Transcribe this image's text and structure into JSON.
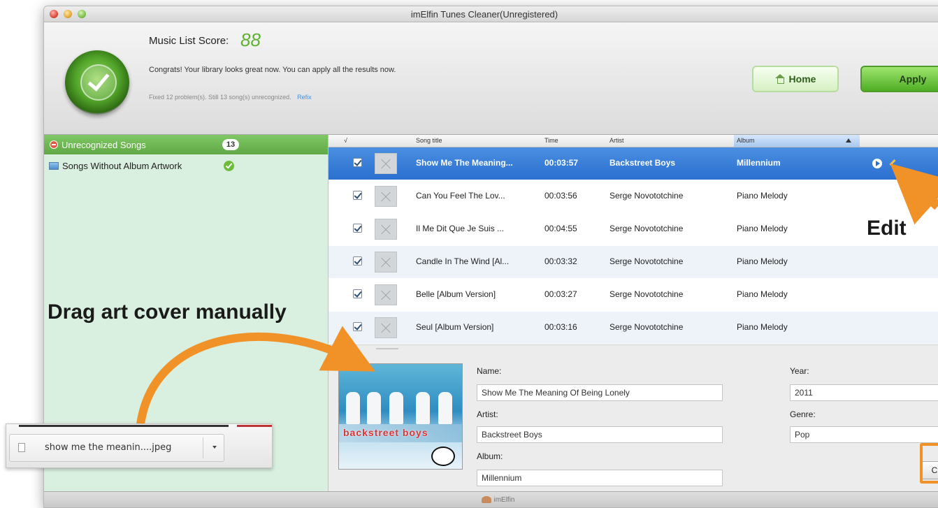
{
  "window": {
    "title": "imElfin Tunes Cleaner(Unregistered)"
  },
  "header": {
    "score_label": "Music List Score:",
    "score_value": "88",
    "congrats": "Congrats! Your library looks great now. You can apply all the results now.",
    "fixed_text": "Fixed 12 problem(s). Still 13 song(s) unrecognized.",
    "refix_link": "Refix",
    "home_label": "Home",
    "apply_label": "Apply"
  },
  "sidebar": {
    "items": [
      {
        "label": "Unrecognized Songs",
        "badge": "13"
      },
      {
        "label": "Songs Without Album Artwork"
      }
    ]
  },
  "table": {
    "headers": {
      "check": "√",
      "song_title": "Song title",
      "time": "Time",
      "artist": "Artist",
      "album": "Album"
    },
    "rows": [
      {
        "title": "Show Me The Meaning...",
        "time": "00:03:57",
        "artist": "Backstreet Boys",
        "album": "Millennium",
        "checked": true
      },
      {
        "title": "Can You Feel The Lov...",
        "time": "00:03:56",
        "artist": "Serge Novototchine",
        "album": "Piano Melody",
        "checked": true
      },
      {
        "title": "Il Me Dit Que Je Suis ...",
        "time": "00:04:55",
        "artist": "Serge Novototchine",
        "album": "Piano Melody",
        "checked": true
      },
      {
        "title": "Candle In The Wind [Al...",
        "time": "00:03:32",
        "artist": "Serge Novototchine",
        "album": "Piano Melody",
        "checked": true
      },
      {
        "title": "Belle [Album Version]",
        "time": "00:03:27",
        "artist": "Serge Novototchine",
        "album": "Piano Melody",
        "checked": true
      },
      {
        "title": "Seul [Album Version]",
        "time": "00:03:16",
        "artist": "Serge Novototchine",
        "album": "Piano Melody",
        "checked": true
      }
    ]
  },
  "detail": {
    "cover_text": "backstreet boys",
    "name_label": "Name:",
    "name_value": "Show Me The Meaning Of Being Lonely",
    "artist_label": "Artist:",
    "artist_value": "Backstreet Boys",
    "album_label": "Album:",
    "album_value": "Millennium",
    "year_label": "Year:",
    "year_value": "2011",
    "genre_label": "Genre:",
    "genre_value": "Pop",
    "close_label": "Close"
  },
  "statusbar": {
    "brand": "imElfin"
  },
  "annotations": {
    "drag_text": "Drag art cover manually",
    "edit_text": "Edit",
    "arrow_color": "#f09228"
  },
  "download": {
    "filename": "show me the meanin....jpeg"
  }
}
